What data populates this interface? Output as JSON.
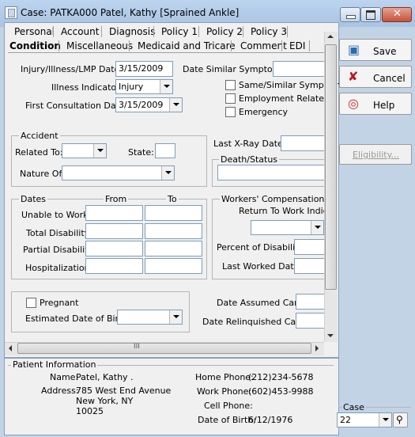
{
  "window": {
    "title": "Case: PATKA000 Patel, Kathy  [Sprained Ankle]"
  },
  "tabs_row1": [
    "Personal",
    "Account",
    "Diagnosis",
    "Policy 1",
    "Policy 2",
    "Policy 3"
  ],
  "tabs_row2": [
    "Condition",
    "Miscellaneous",
    "Medicaid and Tricare",
    "Comment",
    "EDI"
  ],
  "form": {
    "injury_date_label": "Injury/Illness/LMP Date:",
    "injury_date": "3/15/2009",
    "similar_symptoms_date_label": "Date Similar Symptoms:",
    "illness_indicator_label": "Illness Indicator:",
    "illness_indicator": "Injury",
    "first_consult_label": "First Consultation Date:",
    "first_consult": "3/15/2009",
    "same_similar_label": "Same/Similar Symptom",
    "employment_related_label": "Employment Related",
    "emergency_label": "Emergency",
    "accident_group": "Accident",
    "related_to_label": "Related To:",
    "state_label": "State:",
    "nature_of_label": "Nature Of:",
    "last_xray_label": "Last X-Ray Date:",
    "death_status_group": "Death/Status",
    "dates_group": "Dates",
    "from_label": "From",
    "to_label": "To",
    "unable_to_work_label": "Unable to Work:",
    "total_disability_label": "Total Disability:",
    "partial_disability_label": "Partial Disability:",
    "hospitalization_label": "Hospitalization:",
    "workers_comp_group": "Workers' Compensation",
    "return_to_work_label": "Return To Work Indica",
    "percent_disability_label": "Percent of Disability:",
    "last_worked_label": "Last Worked Date:",
    "pregnant_label": "Pregnant",
    "est_birth_label": "Estimated Date of Birth:",
    "date_assumed_label": "Date Assumed Care:",
    "date_relinquished_label": "Date Relinquished Care:"
  },
  "buttons": {
    "save": "Save",
    "cancel": "Cancel",
    "help": "Help",
    "eligibility": "Eligibility..."
  },
  "patient": {
    "group": "Patient Information",
    "name_label": "Name:",
    "name": "Patel, Kathy .",
    "address_label": "Address:",
    "address_line1": "785 West End Avenue",
    "address_line2": "New York, NY",
    "address_line3": "10025",
    "home_phone_label": "Home Phone:",
    "home_phone": "(212)234-5678",
    "work_phone_label": "Work Phone:",
    "work_phone": "(602)453-9988",
    "cell_phone_label": "Cell Phone:",
    "cell_phone": "",
    "dob_label": "Date of Birth:",
    "dob": "6/12/1976"
  },
  "case_selector": {
    "label": "Case",
    "value": "22"
  },
  "scrollbar": {
    "h_grip": "III"
  }
}
